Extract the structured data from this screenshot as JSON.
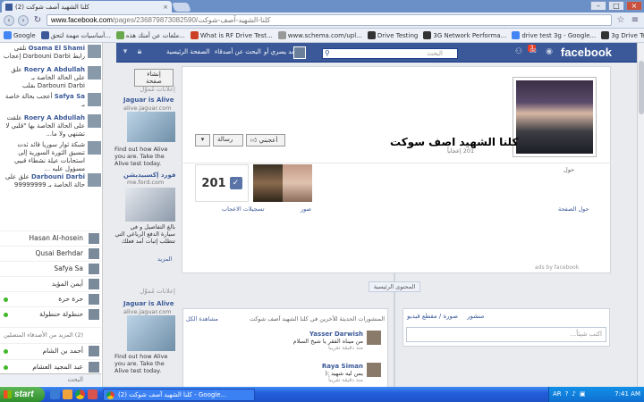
{
  "browser": {
    "tab_title": "كلنا الشهيد آصف شوكت (2)",
    "url_host": "www.facebook.com",
    "url_path": "/pages/كلنا-الشهيد-آصف-شوكت/236879873082590",
    "bookmarks": [
      {
        "label": "Google",
        "color": "#4285f4"
      },
      {
        "label": "أساسيات مهمة لتحق...",
        "color": "#3b5998"
      },
      {
        "label": "ملفات عن أمنك هذه...",
        "color": "#6aa84f"
      },
      {
        "label": "What is RF Drive Test...",
        "color": "#cc4125"
      },
      {
        "label": "www.schema.com/upl...",
        "color": "#999999"
      },
      {
        "label": "Drive Testing",
        "color": "#333333"
      },
      {
        "label": "3G Network Performa...",
        "color": "#333333"
      },
      {
        "label": "drive test 3g - Google...",
        "color": "#4285f4"
      },
      {
        "label": "3g Drive Test Learning",
        "color": "#333333"
      }
    ]
  },
  "fb": {
    "logo": "facebook",
    "search_placeholder": "البحث",
    "nav_home": "الصفحة الرئيسية",
    "nav_find": "البحث عن أصدقاء",
    "nav_user": "محمد يسري أو",
    "notif_count": "3"
  },
  "ticker": [
    {
      "name": "Osama El Shami",
      "text": "تلقى رابط Darbouni Darbi إعجاب"
    },
    {
      "name": "Roery A Abdullah",
      "text": "علق على الحالة الخاصة بـ Darbouni Darbi بقلب"
    },
    {
      "name": "Safya Sa",
      "text": "أعجب بحالة خاصة بـ"
    },
    {
      "name": "Roery A Abdullah",
      "text": "علقت على الحالة الخاصة بها \"قلبي لا تشتهي ولا ما..."
    },
    {
      "name": "",
      "text": "شبكة ثوار سوريا قائد ثدت تنسيق الثورة السورية إلى استجابات عيلة نشطاء قبيي مسؤول عليه ..."
    },
    {
      "name": "Darbouni Darbi",
      "text": "علق على حالة الخاصة بـ 99999999"
    }
  ],
  "chat": {
    "friends": [
      {
        "name": "Hasan Al-hosein",
        "online": false
      },
      {
        "name": "Qusai Berhdar",
        "online": false
      },
      {
        "name": "Safya Sa",
        "online": false
      },
      {
        "name": "أيمن المؤيد",
        "online": false
      },
      {
        "name": "حرة حرة",
        "online": true
      },
      {
        "name": "حنطولة حنطولة",
        "online": true
      },
      {
        "name": "(2) المزيد من الأصدقاء المتصلين",
        "online": false
      },
      {
        "name": "أحمد بن الشام",
        "online": true
      },
      {
        "name": "عبد المجيد العشام",
        "online": true
      }
    ],
    "search_placeholder": "البحث"
  },
  "ads": {
    "create_btn": "إنشاء صفحة",
    "header": "إعلانات مُموَّل",
    "ad1_title": "Jaguar is Alive",
    "ad1_url": "alive.jaguar.com",
    "ad1_text": "Find out how Alive you are. Take the Alive test today.",
    "ad2_title": "فورد إكسبيديشن",
    "ad2_url": "me.ford.com",
    "ad2_text": "بالغ التفاصيل و في سيارة الدفع الرباعي التي تتطلب إثبات أمد فعلك",
    "more": "المزيد",
    "header2": "إعلانات مُموَّل",
    "ad3_title": "Jaguar is Alive",
    "ad3_url": "alive.jaguar.com",
    "ad3_text": "Find out how Alive you are. Take the Alive test today."
  },
  "page": {
    "title": "كلنا الشهيد اصف سوكت",
    "subtitle": "201 إعجاباً",
    "btn_like": "أعجبني",
    "btn_message": "رسالة",
    "about": "حول",
    "likes_count": "201",
    "likes_label": "تسجيلات الاعجاب",
    "photos_label": "صور",
    "about_page": "حول الصفحة",
    "ads_by": "ads by facebook"
  },
  "timeline": {
    "btn": "المحتوى الرئيسية",
    "composer_tabs": [
      "منشور",
      "صورة / مقطع فيديو"
    ],
    "composer_placeholder": "اكتب شيئاً...",
    "recent_title": "المنشورات الحديثة للآخرين في كلنا الشهيد آصف شوكت",
    "recent_link": "مشاهدة الكل",
    "posts": [
      {
        "name": "Yasser Darwish",
        "text": "من ميناه الفقر يا شيخ السلام",
        "meta": "منذ دقيقة تقريباً"
      },
      {
        "name": "Raya Siman",
        "text": "يمن ليه شهيد :(",
        "meta": "منذ دقيقة تقريباً"
      }
    ]
  },
  "taskbar": {
    "start": "start",
    "task": "كلنا الشهيد آصف شوكت (2) - Google...",
    "lang": "AR",
    "time": "7:41 AM"
  }
}
